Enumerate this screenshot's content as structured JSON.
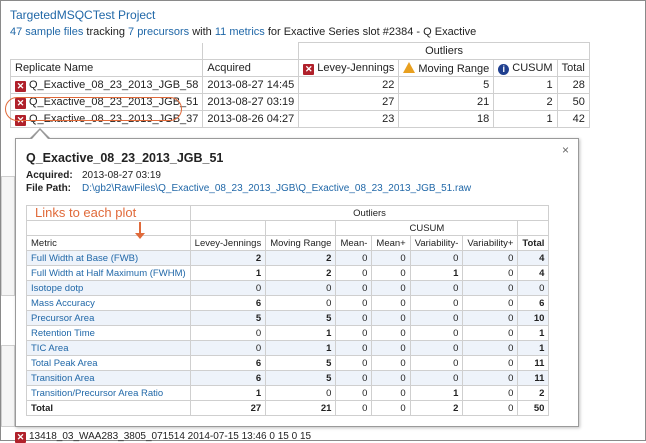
{
  "project_title": "TargetedMSQCTest Project",
  "summary": {
    "files_link": "47 sample files",
    "text1": " tracking ",
    "precursors_link": "7 precursors",
    "text2": " with ",
    "metrics_link": "11 metrics",
    "text3": " for Exactive Series slot #2384 - Q Exactive"
  },
  "bg_table": {
    "outliers_header": "Outliers",
    "col_replicate": "Replicate Name",
    "col_acquired": "Acquired",
    "col_lj": "Levey-Jennings",
    "col_mr": "Moving Range",
    "col_cusum": "CUSUM",
    "col_total": "Total",
    "rows": [
      {
        "name": "Q_Exactive_08_23_2013_JGB_58",
        "acquired": "2013-08-27 14:45",
        "lj": "22",
        "mr": "5",
        "cusum": "1",
        "total": "28"
      },
      {
        "name": "Q_Exactive_08_23_2013_JGB_51",
        "acquired": "2013-08-27 03:19",
        "lj": "27",
        "mr": "21",
        "cusum": "2",
        "total": "50"
      },
      {
        "name": "Q_Exactive_08_23_2013_JGB_37",
        "acquired": "2013-08-26 04:27",
        "lj": "23",
        "mr": "18",
        "cusum": "1",
        "total": "42"
      }
    ],
    "bottom_row": "13418_03_WAA283_3805_071514   2014-07-15 13:46                                  0                    15                     0         15"
  },
  "popup": {
    "title": "Q_Exactive_08_23_2013_JGB_51",
    "acquired_label": "Acquired:",
    "acquired_value": "2013-08-27 03:19",
    "path_label": "File Path:",
    "path_value": "D:\\gb2\\RawFiles\\Q_Exactive_08_23_2013_JGB\\Q_Exactive_08_23_2013_JGB_51.raw",
    "close": "×",
    "outliers_header": "Outliers",
    "cusum_header": "CUSUM",
    "headers": {
      "metric": "Metric",
      "lj": "Levey-Jennings",
      "mr": "Moving Range",
      "mean_minus": "Mean-",
      "mean_plus": "Mean+",
      "var_minus": "Variability-",
      "var_plus": "Variability+",
      "total": "Total"
    },
    "rows": [
      {
        "metric": "Full Width at Base (FWB)",
        "lj": "2",
        "mr": "2",
        "mm": "0",
        "mp": "0",
        "vm": "0",
        "vp": "0",
        "total": "4"
      },
      {
        "metric": "Full Width at Half Maximum (FWHM)",
        "lj": "1",
        "mr": "2",
        "mm": "0",
        "mp": "0",
        "vm": "1",
        "vp": "0",
        "total": "4"
      },
      {
        "metric": "Isotope dotp",
        "lj": "0",
        "mr": "0",
        "mm": "0",
        "mp": "0",
        "vm": "0",
        "vp": "0",
        "total": "0"
      },
      {
        "metric": "Mass Accuracy",
        "lj": "6",
        "mr": "0",
        "mm": "0",
        "mp": "0",
        "vm": "0",
        "vp": "0",
        "total": "6"
      },
      {
        "metric": "Precursor Area",
        "lj": "5",
        "mr": "5",
        "mm": "0",
        "mp": "0",
        "vm": "0",
        "vp": "0",
        "total": "10"
      },
      {
        "metric": "Retention Time",
        "lj": "0",
        "mr": "1",
        "mm": "0",
        "mp": "0",
        "vm": "0",
        "vp": "0",
        "total": "1"
      },
      {
        "metric": "TIC Area",
        "lj": "0",
        "mr": "1",
        "mm": "0",
        "mp": "0",
        "vm": "0",
        "vp": "0",
        "total": "1"
      },
      {
        "metric": "Total Peak Area",
        "lj": "6",
        "mr": "5",
        "mm": "0",
        "mp": "0",
        "vm": "0",
        "vp": "0",
        "total": "11"
      },
      {
        "metric": "Transition Area",
        "lj": "6",
        "mr": "5",
        "mm": "0",
        "mp": "0",
        "vm": "0",
        "vp": "0",
        "total": "11"
      },
      {
        "metric": "Transition/Precursor Area Ratio",
        "lj": "1",
        "mr": "0",
        "mm": "0",
        "mp": "0",
        "vm": "1",
        "vp": "0",
        "total": "2"
      }
    ],
    "total_row": {
      "metric": "Total",
      "lj": "27",
      "mr": "21",
      "mm": "0",
      "mp": "0",
      "vm": "2",
      "vp": "0",
      "total": "50"
    }
  },
  "annotation": "Links to each plot",
  "colors": {
    "link": "#2168a8",
    "annotation": "#e06a3a",
    "outlier_icon": "#b0202a"
  }
}
